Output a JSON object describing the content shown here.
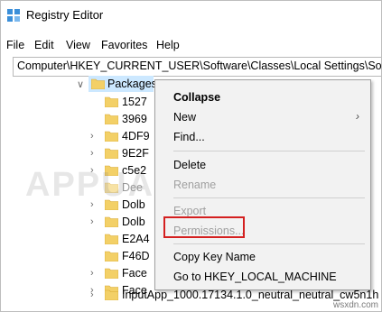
{
  "window": {
    "title": "Registry Editor",
    "icon": "regedit-icon"
  },
  "menu": [
    "File",
    "Edit",
    "View",
    "Favorites",
    "Help"
  ],
  "address": "Computer\\HKEY_CURRENT_USER\\Software\\Classes\\Local Settings\\Software",
  "tree": {
    "selected": "Packages",
    "children": [
      "1527",
      "3969",
      "4DF9",
      "9E2F",
      "c5e2",
      "Dee",
      "Dolb",
      "Dolb",
      "E2A4",
      "F46D",
      "Face",
      "Face",
      "InputApp_1000.17134.1.0_neutral_neutral_cw5n1h"
    ]
  },
  "context_menu": {
    "items": [
      {
        "label": "Collapse",
        "bold": true,
        "disabled": false
      },
      {
        "label": "New",
        "bold": false,
        "disabled": false,
        "submenu": true
      },
      {
        "label": "Find...",
        "bold": false,
        "disabled": false
      },
      {
        "sep": true
      },
      {
        "label": "Delete",
        "bold": false,
        "disabled": false
      },
      {
        "label": "Rename",
        "bold": false,
        "disabled": true
      },
      {
        "sep": true
      },
      {
        "label": "Export",
        "bold": false,
        "disabled": true
      },
      {
        "label": "Permissions...",
        "bold": false,
        "disabled": true,
        "highlighted": true
      },
      {
        "sep": true
      },
      {
        "label": "Copy Key Name",
        "bold": false,
        "disabled": false
      },
      {
        "label": "Go to HKEY_LOCAL_MACHINE",
        "bold": false,
        "disabled": false
      }
    ]
  },
  "watermark": "APPUALS",
  "credit": "wsxdn.com",
  "colors": {
    "highlight": "#d42020",
    "selection": "#cce8ff",
    "menu_bg": "#f2f2f2"
  }
}
